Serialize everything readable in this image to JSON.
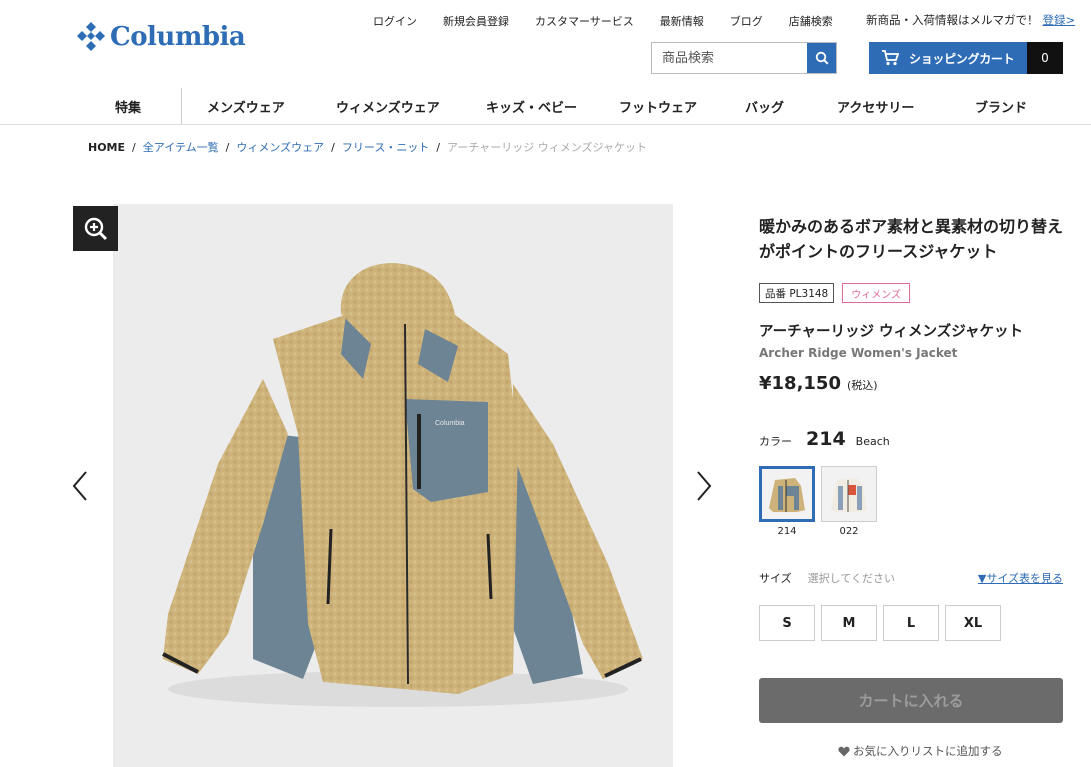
{
  "brand": {
    "name": "Columbia",
    "color": "#2e6db5"
  },
  "util_nav": [
    "ログイン",
    "新規会員登録",
    "カスタマーサービス",
    "最新情報",
    "ブログ",
    "店舗検索"
  ],
  "newsletter": {
    "text": "新商品・入荷情報はメルマガで！",
    "link": "登録>"
  },
  "search": {
    "placeholder": "商品検索",
    "icon": "search-icon"
  },
  "cart": {
    "label": "ショッピングカート",
    "count": "0",
    "icon": "cart-icon"
  },
  "main_nav": [
    "特集",
    "メンズウェア",
    "ウィメンズウェア",
    "キッズ・ベビー",
    "フットウェア",
    "バッグ",
    "アクセサリー",
    "ブランド"
  ],
  "breadcrumb": {
    "home": "HOME",
    "links": [
      "全アイテム一覧",
      "ウィメンズウェア",
      "フリース・ニット"
    ],
    "current": "アーチャーリッジ ウィメンズジャケット"
  },
  "product": {
    "headline": "暖かみのあるボア素材と異素材の切り替えがポイントのフリースジャケット",
    "sku": "品番 PL3148",
    "category_tag": "ウィメンズ",
    "name_ja": "アーチャーリッジ ウィメンズジャケット",
    "name_en": "Archer Ridge Women's Jacket",
    "price": "¥18,150",
    "tax": "(税込)",
    "color_label": "カラー",
    "color_code": "214",
    "color_name": "Beach",
    "swatches": [
      {
        "code": "214",
        "selected": true
      },
      {
        "code": "022",
        "selected": false
      }
    ],
    "size_label": "サイズ",
    "size_hint": "選択してください",
    "size_chart": "▼サイズ表を見る",
    "sizes": [
      "S",
      "M",
      "L",
      "XL"
    ],
    "add_to_cart": "カートに入れる",
    "wishlist": "お気に入りリストに追加する",
    "jacket_logo": "Columbia"
  },
  "colors": {
    "accent": "#2e6db5",
    "fleece": "#cdb27a",
    "panel": "#6d8494",
    "tag_pink": "#e06a9a"
  }
}
